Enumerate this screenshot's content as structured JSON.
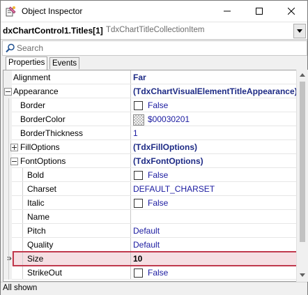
{
  "window": {
    "title": "Object Inspector",
    "icon": "object-inspector-app-icon",
    "controls": [
      "minimize-icon",
      "maximize-icon",
      "close-icon"
    ]
  },
  "object_selector": {
    "object_name": "dxChartControl1.Titles[1]",
    "object_type": "TdxChartTitleCollectionItem"
  },
  "search": {
    "placeholder": "Search"
  },
  "tabs": [
    {
      "label": "Properties",
      "active": true
    },
    {
      "label": "Events",
      "active": false
    }
  ],
  "properties": [
    {
      "name": "Alignment",
      "value": "Far",
      "kind": "text-bold"
    },
    {
      "name": "Appearance",
      "value": "(TdxChartVisualElementTitleAppearance)",
      "kind": "text-bold",
      "expander": "expanded",
      "name_color": "#1d2a85"
    },
    {
      "name": "Border",
      "value": "False",
      "kind": "checkbox"
    },
    {
      "name": "BorderColor",
      "value": "$00030201",
      "kind": "color"
    },
    {
      "name": "BorderThickness",
      "value": "1",
      "kind": "text"
    },
    {
      "name": "FillOptions",
      "value": "(TdxFillOptions)",
      "kind": "text-bold",
      "expander": "collapsed"
    },
    {
      "name": "FontOptions",
      "value": "(TdxFontOptions)",
      "kind": "text-bold",
      "expander": "expanded"
    },
    {
      "name": "Bold",
      "value": "False",
      "kind": "checkbox"
    },
    {
      "name": "Charset",
      "value": "DEFAULT_CHARSET",
      "kind": "text"
    },
    {
      "name": "Italic",
      "value": "False",
      "kind": "checkbox"
    },
    {
      "name": "Name",
      "value": "",
      "kind": "text"
    },
    {
      "name": "Pitch",
      "value": "Default",
      "kind": "text"
    },
    {
      "name": "Quality",
      "value": "Default",
      "kind": "text"
    },
    {
      "name": "Size",
      "value": "10",
      "kind": "text-selected",
      "selected": true
    },
    {
      "name": "StrikeOut",
      "value": "False",
      "kind": "checkbox"
    }
  ],
  "status": {
    "text": "All shown"
  },
  "colors": {
    "selected_row": "#f5dfe3",
    "selected_border": "#c0394d",
    "value_blue": "#1a1aa0",
    "value_bold": "#1d2a85"
  }
}
